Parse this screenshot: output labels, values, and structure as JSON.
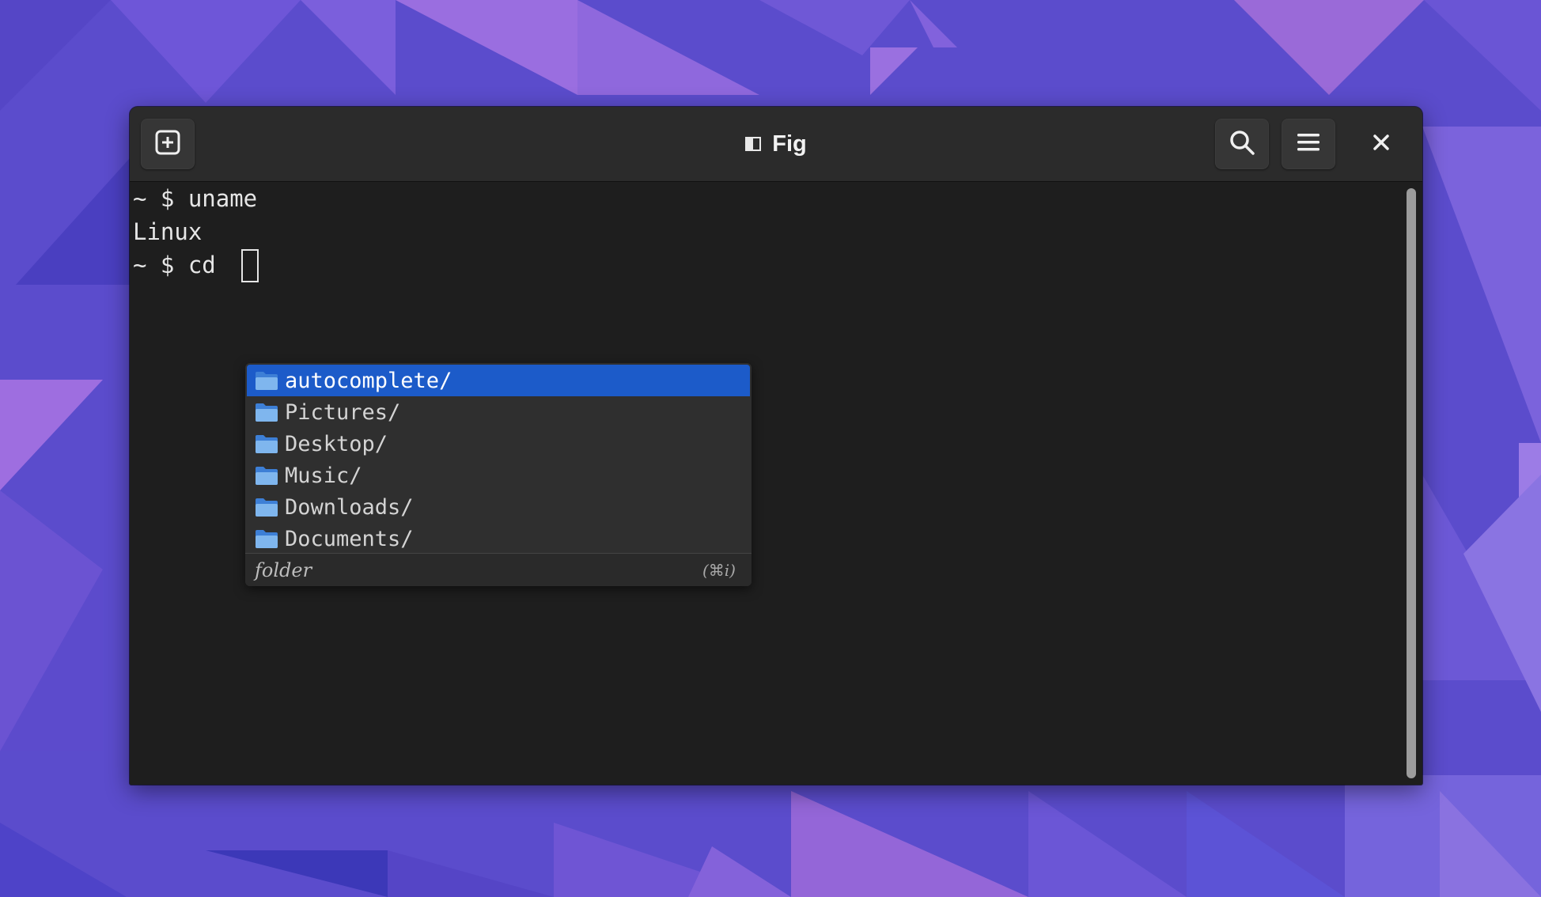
{
  "window": {
    "title": "Fig"
  },
  "headerbar": {
    "new_tab_icon": "new-tab-icon",
    "search_icon": "search-icon",
    "menu_icon": "hamburger-menu-icon",
    "close_icon": "close-icon"
  },
  "terminal": {
    "lines": [
      "~ $ uname",
      "Linux",
      "~ $ cd "
    ]
  },
  "autocomplete": {
    "items": [
      {
        "label": "autocomplete/",
        "icon": "folder-icon",
        "selected": true
      },
      {
        "label": "Pictures/",
        "icon": "folder-icon",
        "selected": false
      },
      {
        "label": "Desktop/",
        "icon": "folder-icon",
        "selected": false
      },
      {
        "label": "Music/",
        "icon": "folder-icon",
        "selected": false
      },
      {
        "label": "Downloads/",
        "icon": "folder-icon",
        "selected": false
      },
      {
        "label": "Documents/",
        "icon": "folder-icon",
        "selected": false
      }
    ],
    "description": "folder",
    "shortcut": "(⌘i)"
  },
  "colors": {
    "selection": "#1c5bc9",
    "terminal_bg": "#1e1e1e",
    "headerbar_bg": "#2b2b2b",
    "folder_blue": "#5aa0e8"
  }
}
